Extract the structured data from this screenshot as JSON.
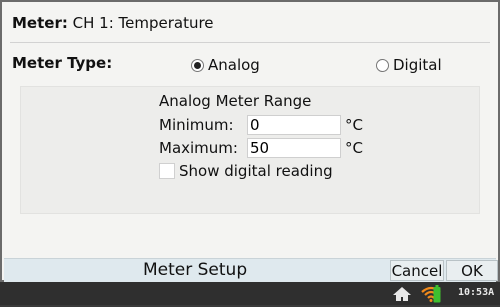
{
  "header": {
    "label": "Meter:",
    "channel": "CH 1: Temperature"
  },
  "meter_type": {
    "label": "Meter Type:",
    "options": [
      {
        "label": "Analog",
        "checked": true
      },
      {
        "label": "Digital",
        "checked": false
      }
    ]
  },
  "range": {
    "title": "Analog Meter Range",
    "minimum": {
      "label": "Minimum:",
      "value": "0",
      "unit": "°C"
    },
    "maximum": {
      "label": "Maximum:",
      "value": "50",
      "unit": "°C"
    },
    "show_digital": {
      "label": "Show digital reading",
      "checked": false
    }
  },
  "footer": {
    "title": "Meter Setup",
    "cancel_label": "Cancel",
    "ok_label": "OK"
  },
  "status": {
    "time": "10:53A",
    "icons": [
      "home-icon",
      "wifi-icon",
      "battery-icon"
    ],
    "battery_color": "#3fbf2f",
    "wifi_color": "#f28a1b"
  }
}
